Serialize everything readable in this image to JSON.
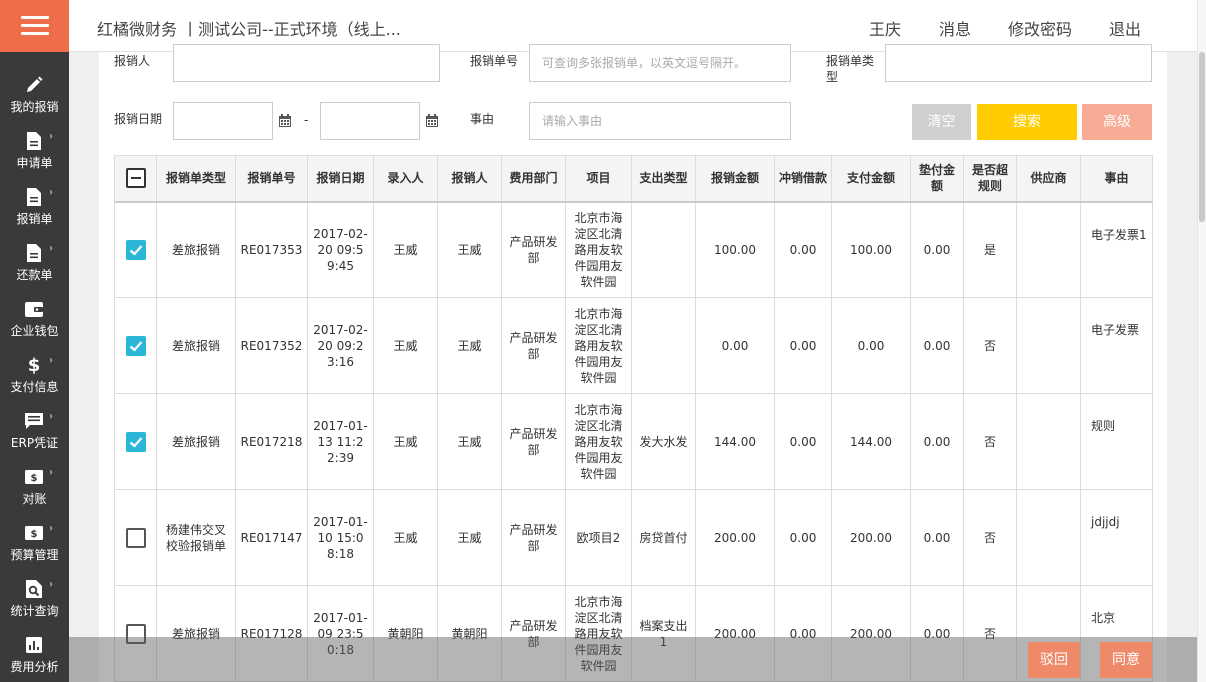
{
  "header": {
    "title": "红橘微财务 丨测试公司--正式环境（线上...",
    "user": "王庆",
    "messages": "消息",
    "change_password": "修改密码",
    "logout": "退出"
  },
  "sidebar": {
    "menu_icon": "hamburger-icon",
    "items": [
      {
        "label": "我的报销",
        "icon": "pencil-icon"
      },
      {
        "label": "申请单",
        "icon": "document-icon"
      },
      {
        "label": "报销单",
        "icon": "document-icon"
      },
      {
        "label": "还款单",
        "icon": "document-icon"
      },
      {
        "label": "企业钱包",
        "icon": "wallet-icon"
      },
      {
        "label": "支付信息",
        "icon": "dollar-icon"
      },
      {
        "label": "ERP凭证",
        "icon": "chat-icon"
      },
      {
        "label": "对账",
        "icon": "money-icon"
      },
      {
        "label": "预算管理",
        "icon": "money-icon"
      },
      {
        "label": "统计查询",
        "icon": "search-doc-icon"
      },
      {
        "label": "费用分析",
        "icon": "bar-chart-icon"
      }
    ]
  },
  "filters": {
    "reimburser_label": "报销人",
    "reimburser_value": "",
    "number_label": "报销单号",
    "number_placeholder": "可查询多张报销单，以英文逗号隔开。",
    "type_label": "报销单类型",
    "type_value": "",
    "date_label": "报销日期",
    "date_from": "",
    "date_sep": "-",
    "date_to": "",
    "reason_label": "事由",
    "reason_placeholder": "请输入事由"
  },
  "buttons": {
    "clear": "清空",
    "search": "搜索",
    "advanced": "高级",
    "reject": "驳回",
    "approve": "同意"
  },
  "colors": {
    "accent": "#ee6e4a",
    "sidebar_bg": "#3a3a3a",
    "search_btn": "#ffcc00",
    "clear_btn": "#cfcfcf",
    "advanced_btn": "#f7ab95",
    "checkbox_on": "#2bb5d6"
  },
  "table": {
    "columns": [
      "报销单类型",
      "报销单号",
      "报销日期",
      "录入人",
      "报销人",
      "费用部门",
      "项目",
      "支出类型",
      "报销金额",
      "冲销借款",
      "支付金额",
      "垫付金额",
      "是否超规则",
      "供应商",
      "事由"
    ],
    "rows": [
      {
        "checked": true,
        "type": "差旅报销",
        "number": "RE017353",
        "date": "2017-02-20 09:59:45",
        "entered_by": "王威",
        "reimburser": "王威",
        "department": "产品研发部",
        "project": "北京市海淀区北清路用友软件园用友软件园",
        "expense_type": "",
        "amount": "100.00",
        "offset": "0.00",
        "paid": "100.00",
        "advance": "0.00",
        "over_rule": "是",
        "supplier": "",
        "reason": "电子发票1"
      },
      {
        "checked": true,
        "type": "差旅报销",
        "number": "RE017352",
        "date": "2017-02-20 09:23:16",
        "entered_by": "王威",
        "reimburser": "王威",
        "department": "产品研发部",
        "project": "北京市海淀区北清路用友软件园用友软件园",
        "expense_type": "",
        "amount": "0.00",
        "offset": "0.00",
        "paid": "0.00",
        "advance": "0.00",
        "over_rule": "否",
        "supplier": "",
        "reason": "电子发票"
      },
      {
        "checked": true,
        "type": "差旅报销",
        "number": "RE017218",
        "date": "2017-01-13 11:22:39",
        "entered_by": "王威",
        "reimburser": "王威",
        "department": "产品研发部",
        "project": "北京市海淀区北清路用友软件园用友软件园",
        "expense_type": "发大水发",
        "amount": "144.00",
        "offset": "0.00",
        "paid": "144.00",
        "advance": "0.00",
        "over_rule": "否",
        "supplier": "",
        "reason": "规则"
      },
      {
        "checked": false,
        "type": "杨建伟交叉校验报销单",
        "number": "RE017147",
        "date": "2017-01-10 15:08:18",
        "entered_by": "王威",
        "reimburser": "王威",
        "department": "产品研发部",
        "project": "欧项目2",
        "expense_type": "房贷首付",
        "amount": "200.00",
        "offset": "0.00",
        "paid": "200.00",
        "advance": "0.00",
        "over_rule": "否",
        "supplier": "",
        "reason": "jdjjdj"
      },
      {
        "checked": false,
        "type": "差旅报销",
        "number": "RE017128",
        "date": "2017-01-09 23:50:18",
        "entered_by": "黄朝阳",
        "reimburser": "黄朝阳",
        "department": "产品研发部",
        "project": "北京市海淀区北清路用友软件园用友软件园",
        "expense_type": "档案支出1",
        "amount": "200.00",
        "offset": "0.00",
        "paid": "200.00",
        "advance": "0.00",
        "over_rule": "否",
        "supplier": "",
        "reason": "北京"
      }
    ]
  }
}
